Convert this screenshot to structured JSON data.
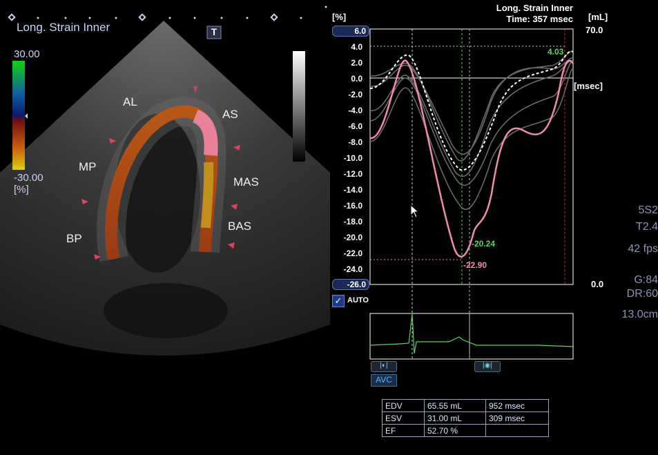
{
  "echo": {
    "title": "Long. Strain Inner",
    "scale_max": "30.00",
    "scale_min": "-30.00",
    "scale_unit": "[%]",
    "tag_letter": "T",
    "segments": [
      {
        "id": "al",
        "label": "AL"
      },
      {
        "id": "as",
        "label": "AS"
      },
      {
        "id": "mp",
        "label": "MP"
      },
      {
        "id": "mas",
        "label": "MAS"
      },
      {
        "id": "bp",
        "label": "BP"
      },
      {
        "id": "bas",
        "label": "BAS"
      }
    ]
  },
  "graph": {
    "y_unit": "[%]",
    "title": "Long. Strain Inner",
    "time_label": "Time: 357 msec",
    "right_unit": "[mL]",
    "right_top": "70.0",
    "right_bottom": "0.0",
    "x_unit": "[msec]",
    "y_max_pill": "6.0",
    "y_min_pill": "-26.0",
    "auto_label": "AUTO",
    "ticks": [
      "4.0",
      "2.0",
      "0.0",
      "-2.0",
      "-4.0",
      "-6.0",
      "-8.0",
      "-10.0",
      "-12.0",
      "-14.0",
      "-16.0",
      "-18.0",
      "-20.0",
      "-22.0",
      "-24.0"
    ],
    "annotations": {
      "peak_green": "-20.24",
      "peak_pink": "-22.90",
      "peak_end": "4.03"
    }
  },
  "controls": {
    "avc_label": "AVC"
  },
  "right_panel": [
    "5S2",
    "T2.4",
    "42 fps",
    "G:84",
    "DR:60",
    "13.0cm"
  ],
  "metrics": [
    [
      "EDV",
      "65.55 mL",
      "952 msec"
    ],
    [
      "ESV",
      "31.00 mL",
      "309 msec"
    ],
    [
      "EF",
      "52.70 %",
      ""
    ]
  ],
  "colors": {
    "pink": "#f28bb0",
    "green": "#5fd35f",
    "accent": "#c9d3f2"
  }
}
